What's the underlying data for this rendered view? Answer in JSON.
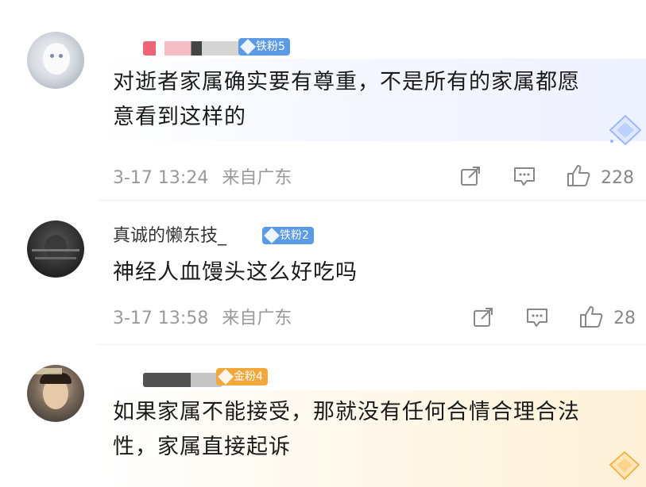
{
  "comments": [
    {
      "badge": "铁粉5",
      "text_line1": "对逝者家属确实要有尊重，不是所有的家属都愿",
      "text_line2": "意看到这样的",
      "time": "3-17 13:24",
      "location": "来自广东",
      "likes": "228"
    },
    {
      "username": "真诚的懒东技_",
      "badge": "铁粉2",
      "text_line1": "神经人血馒头这么好吃吗",
      "time": "3-17 13:58",
      "location": "来自广东",
      "likes": "28"
    },
    {
      "badge": "金粉4",
      "text_line1": "如果家属不能接受，那就没有任何合情合理合法",
      "text_line2": "性，家属直接起诉"
    }
  ],
  "colors": {
    "iron_badge": "#5b9be6",
    "gold_badge": "#f1a73a",
    "meta_text": "#999999"
  },
  "icons": {
    "share": "share-icon",
    "comment": "comment-icon",
    "like": "thumbs-up-icon"
  }
}
